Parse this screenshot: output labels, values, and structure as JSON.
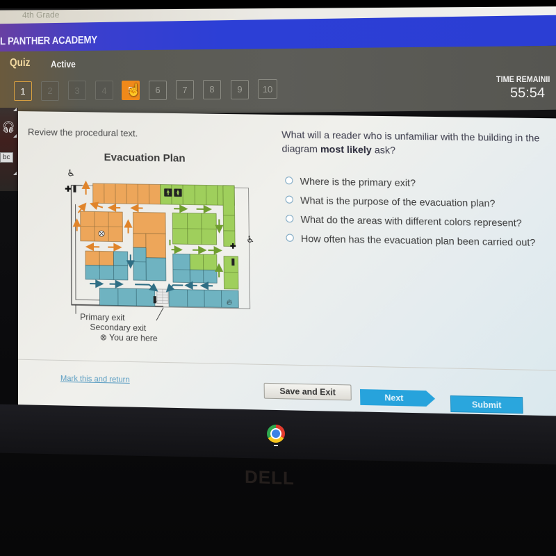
{
  "browser": {
    "tab_text": "4th Grade"
  },
  "header": {
    "brand": "L PANTHER ACADEMY"
  },
  "quiz_bar": {
    "section_label": "Quiz",
    "status_label": "Active",
    "questions": [
      {
        "label": "1",
        "state": "done"
      },
      {
        "label": "2",
        "state": "dim"
      },
      {
        "label": "3",
        "state": "dim"
      },
      {
        "label": "4",
        "state": "dim"
      },
      {
        "label": "5",
        "state": "current"
      },
      {
        "label": "6",
        "state": "todo"
      },
      {
        "label": "7",
        "state": "todo"
      },
      {
        "label": "8",
        "state": "todo"
      },
      {
        "label": "9",
        "state": "todo"
      },
      {
        "label": "10",
        "state": "todo"
      }
    ],
    "timer_label": "TIME REMAINII",
    "timer_value": "55:54"
  },
  "side_tools": [
    {
      "icon": "headphones-icon"
    },
    {
      "icon": "dictionary-icon",
      "text": "bc"
    }
  ],
  "left_pane": {
    "instruction": "Review the procedural text.",
    "diagram_title": "Evacuation Plan",
    "legend": {
      "primary_exit": "Primary exit",
      "secondary_exit": "Secondary exit",
      "you_are_here": "⊗ You are here"
    },
    "colors": {
      "orange": "#eda65a",
      "green": "#9fcf5c",
      "teal": "#6fb3c1",
      "orange_arrow": "#e0842a",
      "green_arrow": "#6f9e2e",
      "teal_arrow": "#2f6e84"
    }
  },
  "right_pane": {
    "question_pre": "What will a reader who is unfamiliar with the building in the diagram ",
    "question_bold": "most likely",
    "question_post": " ask?",
    "options": [
      "Where is the primary exit?",
      "What is the purpose of the evacuation plan?",
      "What do the areas with different colors represent?",
      "How often has the evacuation plan been carried out?"
    ]
  },
  "footer": {
    "mark_link": "Mark this and return",
    "save_exit": "Save and Exit",
    "next": "Next",
    "submit": "Submit"
  },
  "taskbar": {
    "app": "chrome-icon"
  },
  "bezel": {
    "logo": "DELL"
  }
}
